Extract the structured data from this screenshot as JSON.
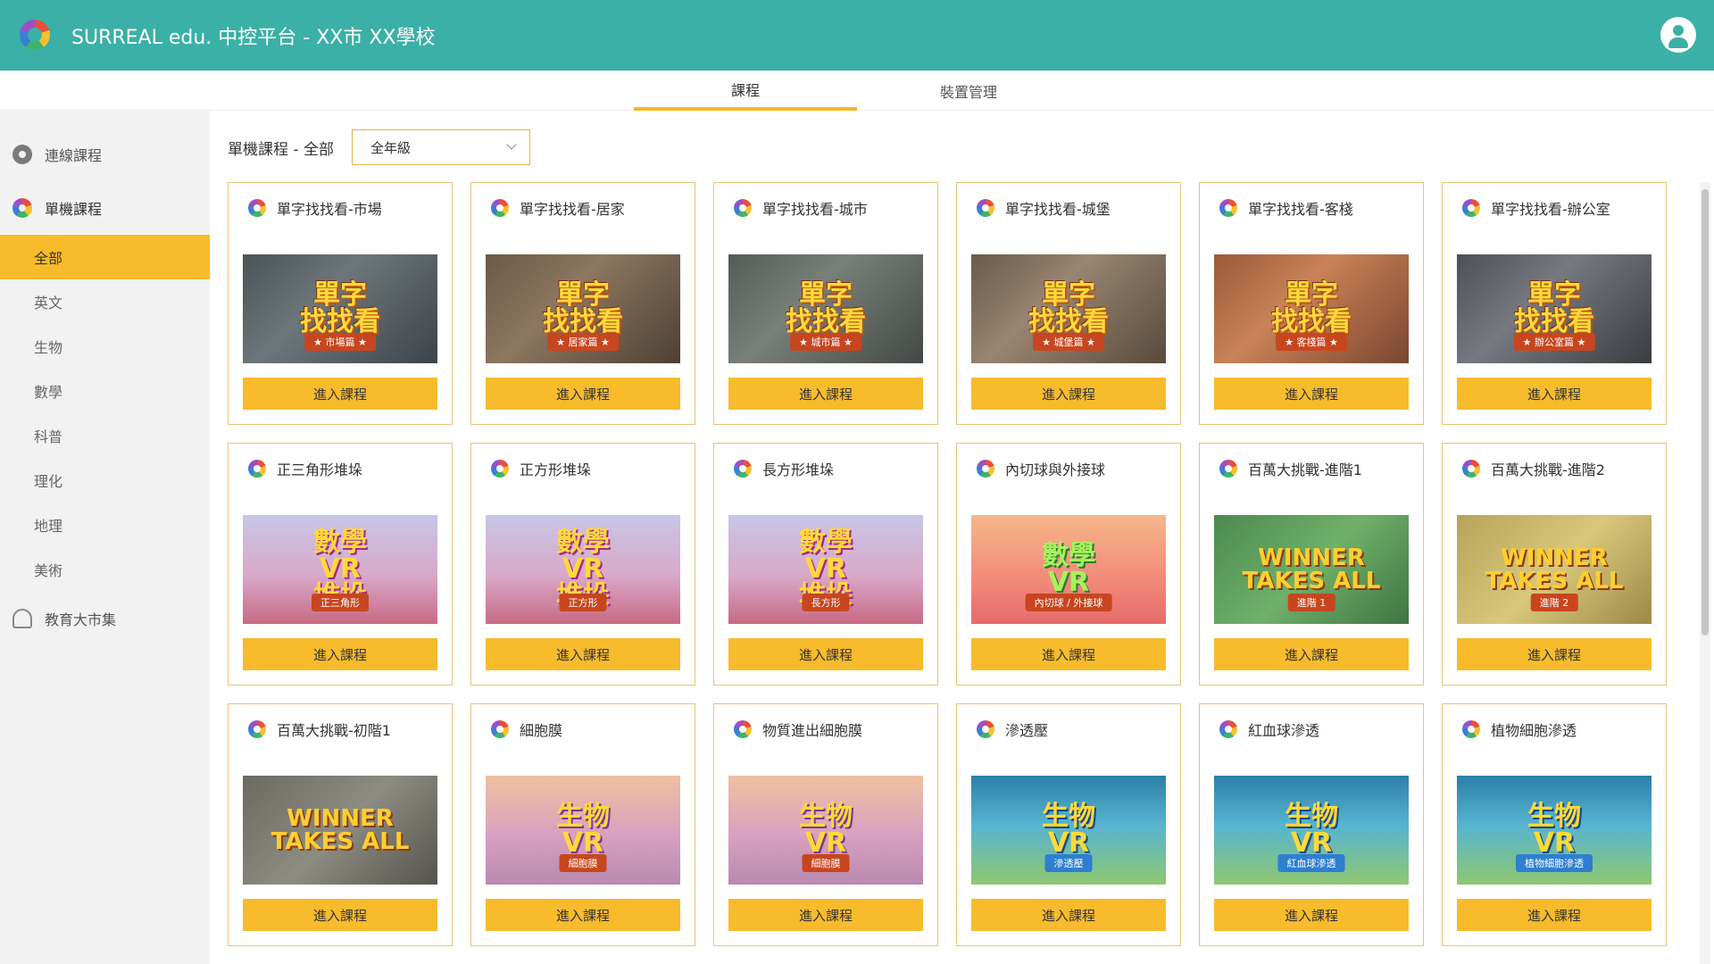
{
  "app": {
    "title": "SURREAL edu. 中控平台 - XX市 XX學校"
  },
  "tabs": [
    {
      "label": "課程",
      "active": true
    },
    {
      "label": "裝置管理",
      "active": false
    }
  ],
  "sidebar": {
    "online_courses": "連線課程",
    "standalone_courses": "單機課程",
    "subjects": [
      "全部",
      "英文",
      "生物",
      "數學",
      "科普",
      "理化",
      "地理",
      "美術"
    ],
    "active_subject": "全部",
    "marketplace": "教育大市集"
  },
  "filter": {
    "label": "單機課程 - 全部",
    "grade_value": "全年級"
  },
  "enter_button_label": "進入課程",
  "courses": [
    {
      "title": "單字找找看-市場",
      "thumb_main": "單字\n找找看",
      "thumb_sub": "★ 市場篇 ★",
      "theme": "th-market"
    },
    {
      "title": "單字找找看-居家",
      "thumb_main": "單字\n找找看",
      "thumb_sub": "★ 居家篇 ★",
      "theme": "th-home"
    },
    {
      "title": "單字找找看-城市",
      "thumb_main": "單字\n找找看",
      "thumb_sub": "★ 城市篇 ★",
      "theme": "th-city"
    },
    {
      "title": "單字找找看-城堡",
      "thumb_main": "單字\n找找看",
      "thumb_sub": "★ 城堡篇 ★",
      "theme": "th-castle"
    },
    {
      "title": "單字找找看-客棧",
      "thumb_main": "單字\n找找看",
      "thumb_sub": "★ 客棧篇 ★",
      "theme": "th-inn"
    },
    {
      "title": "單字找找看-辦公室",
      "thumb_main": "單字\n找找看",
      "thumb_sub": "★ 辦公室篇 ★",
      "theme": "th-office"
    },
    {
      "title": "正三角形堆垛",
      "thumb_main": "數學\nVR\n堆垛",
      "thumb_sub": "正三角形",
      "theme": "th-stack"
    },
    {
      "title": "正方形堆垛",
      "thumb_main": "數學\nVR\n堆垛",
      "thumb_sub": "正方形",
      "theme": "th-stack"
    },
    {
      "title": "長方形堆垛",
      "thumb_main": "數學\nVR\n堆垛",
      "thumb_sub": "長方形",
      "theme": "th-stack"
    },
    {
      "title": "內切球與外接球",
      "thumb_main": "數學\nVR",
      "thumb_sub": "內切球 / 外接球",
      "theme": "th-sphere"
    },
    {
      "title": "百萬大挑戰-進階1",
      "thumb_main": "WINNER\nTAKES ALL",
      "thumb_sub": "進階 1",
      "theme": "th-winner"
    },
    {
      "title": "百萬大挑戰-進階2",
      "thumb_main": "WINNER\nTAKES ALL",
      "thumb_sub": "進階 2",
      "theme": "th-winner2"
    },
    {
      "title": "百萬大挑戰-初階1",
      "thumb_main": "WINNER\nTAKES ALL",
      "thumb_sub": "",
      "theme": "th-winner3"
    },
    {
      "title": "細胞膜",
      "thumb_main": "生物\nVR",
      "thumb_sub": "細胞膜",
      "theme": "th-cell"
    },
    {
      "title": "物質進出細胞膜",
      "thumb_main": "生物\nVR",
      "thumb_sub": "細胞膜",
      "theme": "th-cell"
    },
    {
      "title": "滲透壓",
      "thumb_main": "生物\nVR",
      "thumb_sub": "滲透壓",
      "theme": "th-bio"
    },
    {
      "title": "紅血球滲透",
      "thumb_main": "生物\nVR",
      "thumb_sub": "紅血球滲透",
      "theme": "th-bio"
    },
    {
      "title": "植物細胞滲透",
      "thumb_main": "生物\nVR",
      "thumb_sub": "植物細胞滲透",
      "theme": "th-bio"
    }
  ]
}
